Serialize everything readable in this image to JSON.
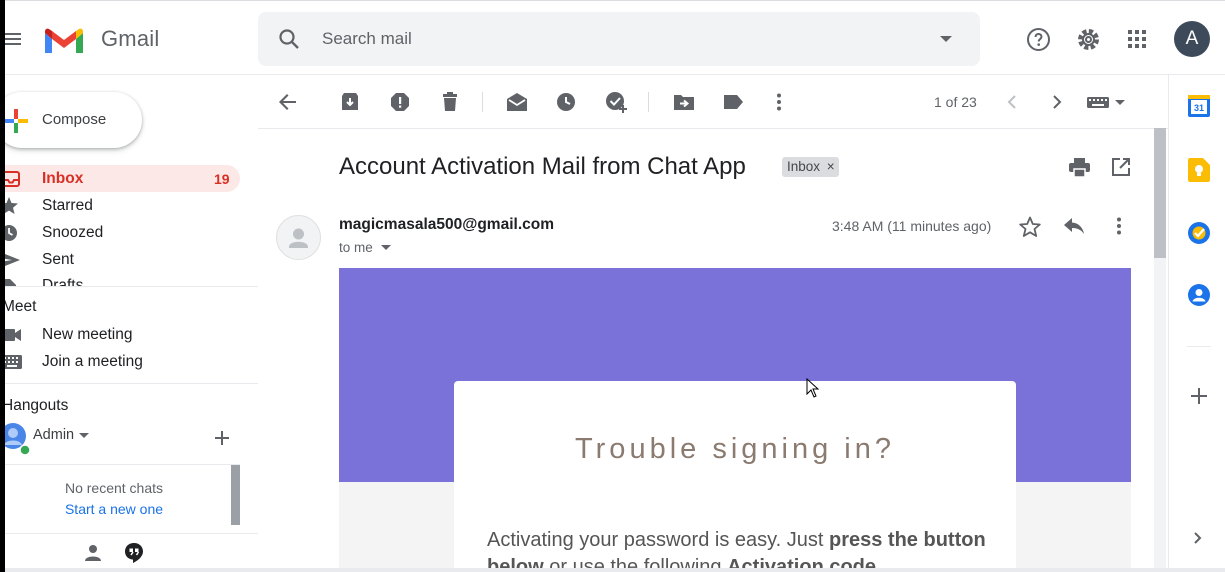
{
  "app": {
    "name": "Gmail"
  },
  "search": {
    "placeholder": "Search mail"
  },
  "header": {
    "avatar_letter": "A"
  },
  "sidebar": {
    "compose_label": "Compose",
    "items": [
      {
        "label": "Inbox",
        "count": "19"
      },
      {
        "label": "Starred"
      },
      {
        "label": "Snoozed"
      },
      {
        "label": "Sent"
      },
      {
        "label": "Drafts"
      }
    ],
    "meet": {
      "title": "Meet",
      "items": [
        {
          "label": "New meeting"
        },
        {
          "label": "Join a meeting"
        }
      ]
    },
    "hangouts": {
      "title": "Hangouts",
      "user": "Admin",
      "no_chats": "No recent chats",
      "start_new": "Start a new one"
    }
  },
  "toolbar": {
    "pager": "1 of 23"
  },
  "message": {
    "subject": "Account Activation Mail from Chat App",
    "label": "Inbox",
    "sender": "magicmasala500@gmail.com",
    "to": "to me",
    "time": "3:48 AM (11 minutes ago)"
  },
  "email_body": {
    "heading": "Trouble signing in?",
    "text_1": "Activating your password is easy. Just ",
    "text_bold_1": "press the button below",
    "text_2": " or use the following ",
    "text_bold_2": "Activation code"
  },
  "colors": {
    "accent_red": "#d93025",
    "inbox_bg": "#fce8e6",
    "email_banner": "#7b72d9",
    "link_blue": "#1a73e8"
  },
  "icons": [
    "menu-icon",
    "search-icon",
    "dropdown-icon",
    "help-icon",
    "settings-icon",
    "apps-icon",
    "back-icon",
    "archive-icon",
    "report-spam-icon",
    "delete-icon",
    "mark-unread-icon",
    "snooze-icon",
    "add-task-icon",
    "move-to-icon",
    "label-icon",
    "more-icon",
    "prev-icon",
    "next-icon",
    "keyboard-icon",
    "print-icon",
    "open-new-window-icon",
    "star-icon",
    "reply-icon",
    "calendar-icon",
    "keep-icon",
    "tasks-icon",
    "contacts-icon",
    "add-icon",
    "expand-icon"
  ]
}
